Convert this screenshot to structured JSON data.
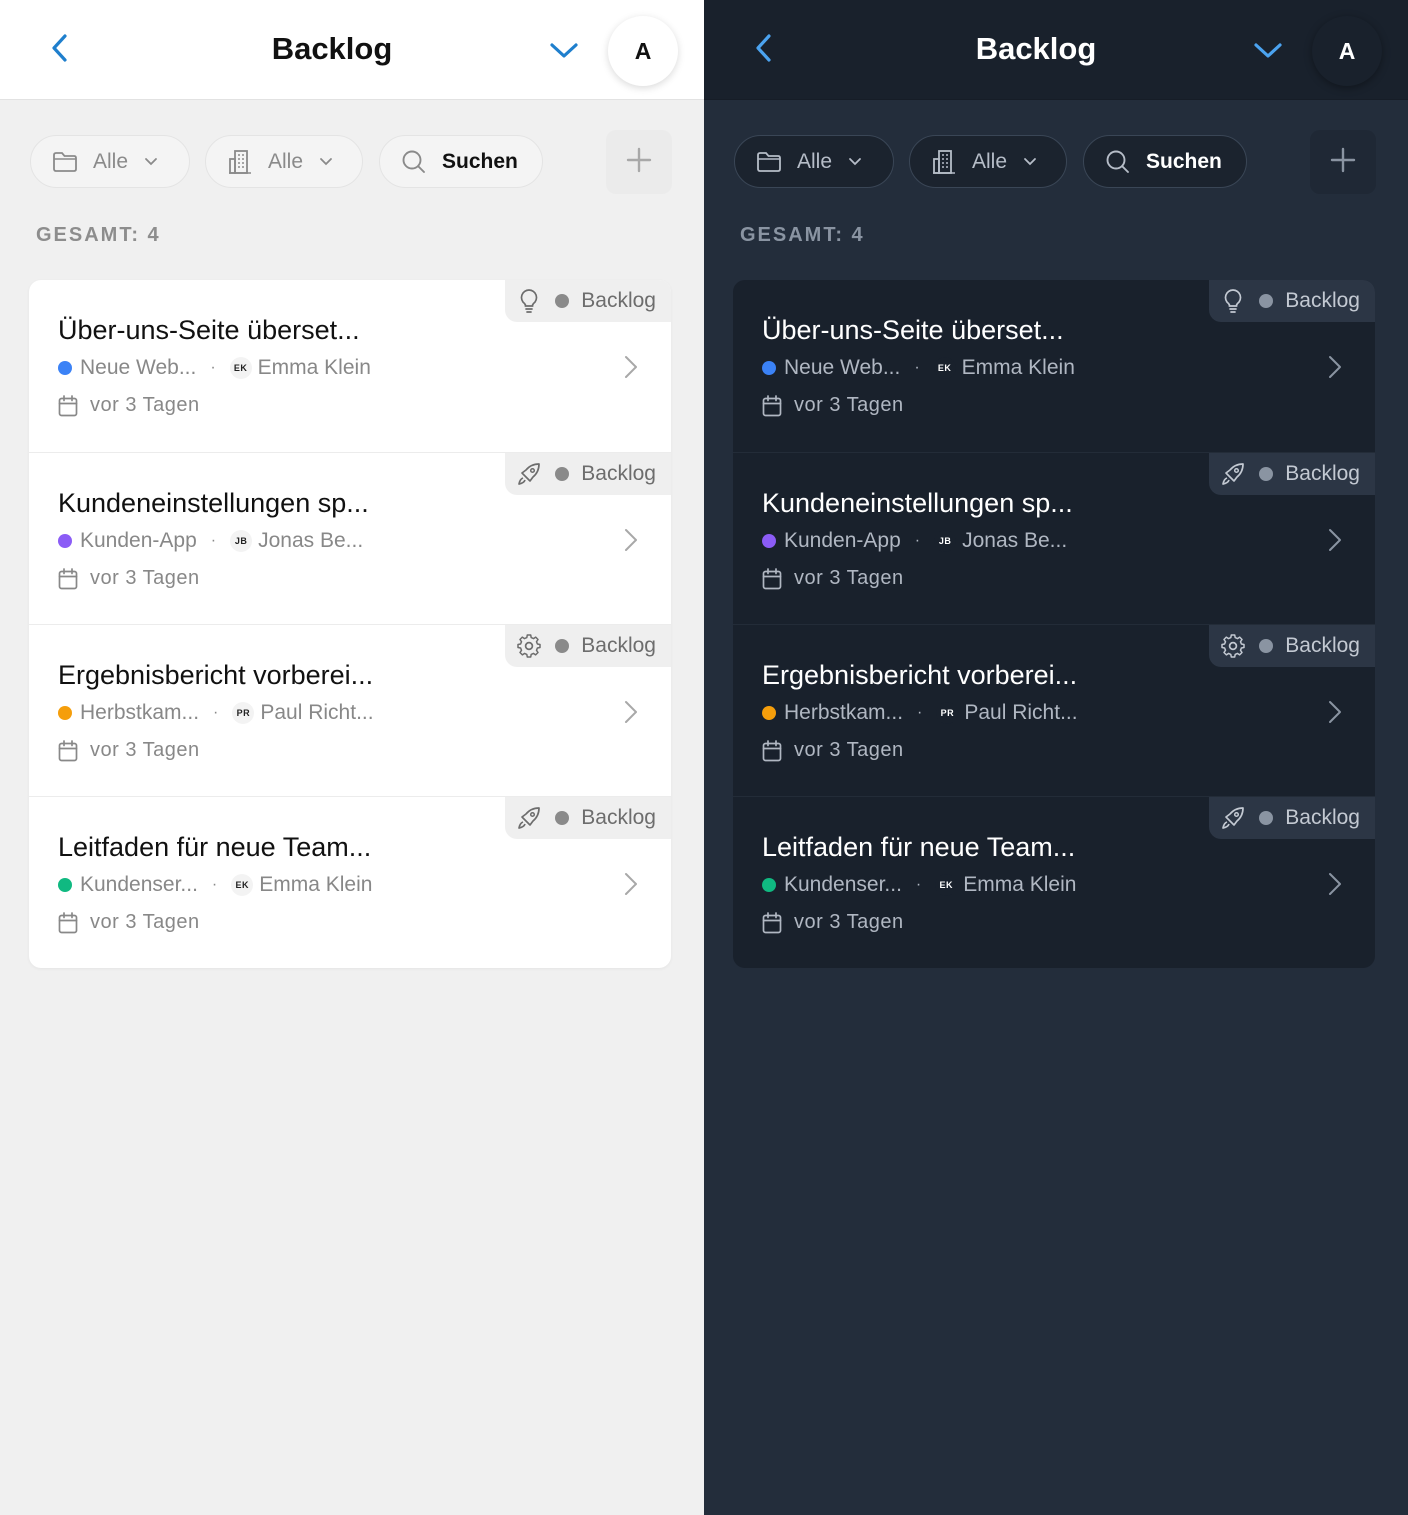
{
  "colors": {
    "accent_light": "#1f7fcd",
    "accent_dark": "#4ba3f0",
    "project_blue": "#3b82f6",
    "project_purple": "#8b5cf6",
    "project_orange": "#f59e0b",
    "project_green": "#10b981"
  },
  "panes": [
    {
      "theme": "light",
      "header": {
        "title": "Backlog",
        "avatar_initial": "A"
      },
      "filters": {
        "project_label": "Alle",
        "company_label": "Alle",
        "search_label": "Suchen"
      },
      "count_label": "GESAMT: 4",
      "tasks": [
        {
          "title": "Über-uns-Seite überset...",
          "type_icon": "lightbulb-icon",
          "status": "Backlog",
          "project": "Neue Web...",
          "project_color": "#3b82f6",
          "assignee_initials": "EK",
          "assignee": "Emma Klein",
          "date": "vor 3 Tagen"
        },
        {
          "title": "Kundeneinstellungen sp...",
          "type_icon": "rocket-icon",
          "status": "Backlog",
          "project": "Kunden-App",
          "project_color": "#8b5cf6",
          "assignee_initials": "JB",
          "assignee": "Jonas Be...",
          "date": "vor 3 Tagen"
        },
        {
          "title": "Ergebnisbericht vorberei...",
          "type_icon": "gear-icon",
          "status": "Backlog",
          "project": "Herbstkam...",
          "project_color": "#f59e0b",
          "assignee_initials": "PR",
          "assignee": "Paul Richt...",
          "date": "vor 3 Tagen"
        },
        {
          "title": "Leitfaden für neue Team...",
          "type_icon": "rocket-icon",
          "status": "Backlog",
          "project": "Kundenser...",
          "project_color": "#10b981",
          "assignee_initials": "EK",
          "assignee": "Emma Klein",
          "date": "vor 3 Tagen"
        }
      ]
    },
    {
      "theme": "dark",
      "header": {
        "title": "Backlog",
        "avatar_initial": "A"
      },
      "filters": {
        "project_label": "Alle",
        "company_label": "Alle",
        "search_label": "Suchen"
      },
      "count_label": "GESAMT: 4",
      "tasks": [
        {
          "title": "Über-uns-Seite überset...",
          "type_icon": "lightbulb-icon",
          "status": "Backlog",
          "project": "Neue Web...",
          "project_color": "#3b82f6",
          "assignee_initials": "EK",
          "assignee": "Emma Klein",
          "date": "vor 3 Tagen"
        },
        {
          "title": "Kundeneinstellungen sp...",
          "type_icon": "rocket-icon",
          "status": "Backlog",
          "project": "Kunden-App",
          "project_color": "#8b5cf6",
          "assignee_initials": "JB",
          "assignee": "Jonas Be...",
          "date": "vor 3 Tagen"
        },
        {
          "title": "Ergebnisbericht vorberei...",
          "type_icon": "gear-icon",
          "status": "Backlog",
          "project": "Herbstkam...",
          "project_color": "#f59e0b",
          "assignee_initials": "PR",
          "assignee": "Paul Richt...",
          "date": "vor 3 Tagen"
        },
        {
          "title": "Leitfaden für neue Team...",
          "type_icon": "rocket-icon",
          "status": "Backlog",
          "project": "Kundenser...",
          "project_color": "#10b981",
          "assignee_initials": "EK",
          "assignee": "Emma Klein",
          "date": "vor 3 Tagen"
        }
      ]
    }
  ]
}
